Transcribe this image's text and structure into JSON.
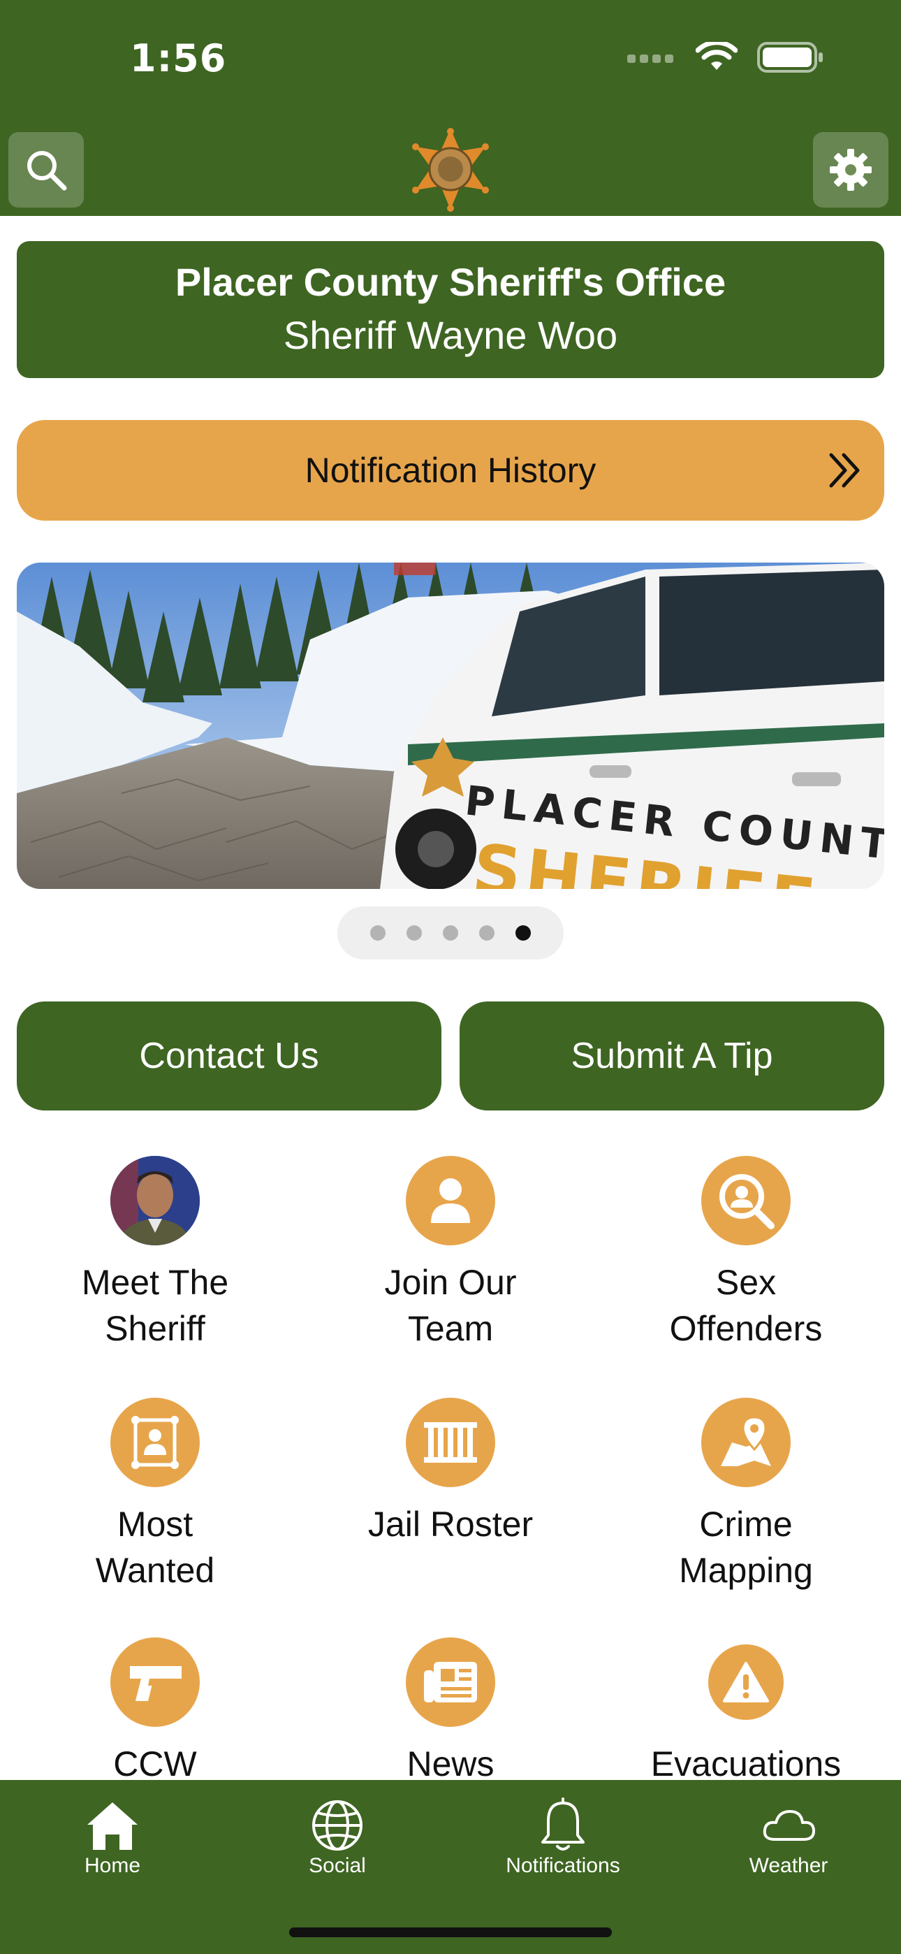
{
  "status_bar": {
    "time": "1:56"
  },
  "header": {
    "search_icon": "search-icon",
    "settings_icon": "gear-icon",
    "logo_icon": "sheriff-star-badge",
    "accent_color": "#3e6522",
    "secondary_color": "#e7a54b"
  },
  "title_card": {
    "title": "Placer County Sheriff's Office",
    "subtitle": "Sheriff Wayne Woo"
  },
  "notification_history": {
    "label": "Notification History",
    "icon": "double-chevron-right-icon"
  },
  "carousel": {
    "slide_count": 5,
    "active_index": 4,
    "vehicle_text": "PLACER COUNTY",
    "vehicle_text_2": "SHERIFF"
  },
  "actions": {
    "contact_label": "Contact Us",
    "tip_label": "Submit A Tip"
  },
  "grid": {
    "items": [
      {
        "label_line1": "Meet The",
        "label_line2": "Sheriff",
        "icon": "sheriff-portrait"
      },
      {
        "label_line1": "Join Our",
        "label_line2": "Team",
        "icon": "person-icon"
      },
      {
        "label_line1": "Sex",
        "label_line2": "Offenders",
        "icon": "magnify-person-icon"
      },
      {
        "label_line1": "Most",
        "label_line2": "Wanted",
        "icon": "wanted-poster-icon"
      },
      {
        "label_line1": "Jail Roster",
        "label_line2": "",
        "icon": "jail-bars-icon"
      },
      {
        "label_line1": "Crime",
        "label_line2": "Mapping",
        "icon": "map-pin-icon"
      },
      {
        "label_line1": "CCW",
        "label_line2": "",
        "icon": "handgun-icon"
      },
      {
        "label_line1": "News",
        "label_line2": "",
        "icon": "newspaper-icon"
      },
      {
        "label_line1": "Evacuations",
        "label_line2": "",
        "icon": "warning-icon"
      }
    ]
  },
  "tabbar": {
    "tabs": [
      {
        "label": "Home",
        "icon": "home-icon"
      },
      {
        "label": "Social",
        "icon": "globe-icon"
      },
      {
        "label": "Notifications",
        "icon": "bell-icon"
      },
      {
        "label": "Weather",
        "icon": "cloud-icon"
      }
    ]
  }
}
